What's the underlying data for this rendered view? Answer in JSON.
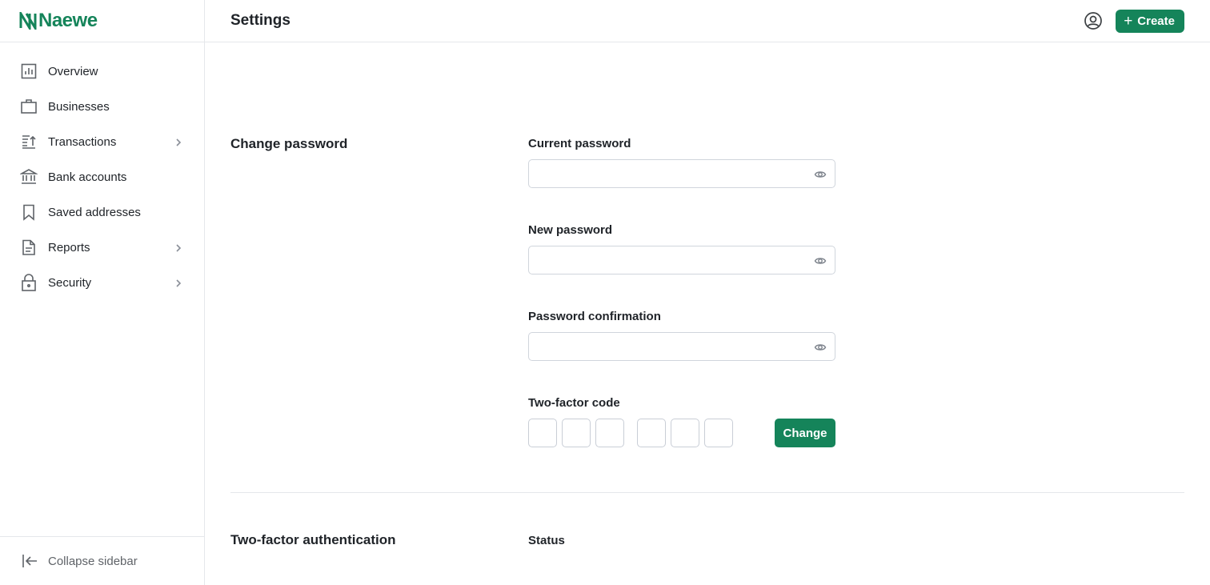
{
  "brand": {
    "name": "Naewe",
    "color": "#15845a"
  },
  "sidebar": {
    "items": [
      {
        "label": "Overview",
        "icon": "bar-chart-icon",
        "has_submenu": false
      },
      {
        "label": "Businesses",
        "icon": "briefcase-icon",
        "has_submenu": false
      },
      {
        "label": "Transactions",
        "icon": "transactions-icon",
        "has_submenu": true
      },
      {
        "label": "Bank accounts",
        "icon": "bank-icon",
        "has_submenu": false
      },
      {
        "label": "Saved addresses",
        "icon": "bookmark-icon",
        "has_submenu": false
      },
      {
        "label": "Reports",
        "icon": "document-icon",
        "has_submenu": true
      },
      {
        "label": "Security",
        "icon": "lock-icon",
        "has_submenu": true
      }
    ],
    "collapse_label": "Collapse sidebar"
  },
  "header": {
    "title": "Settings",
    "create_label": "Create"
  },
  "change_password": {
    "section_title": "Change password",
    "current_password_label": "Current password",
    "current_password_value": "",
    "new_password_label": "New password",
    "new_password_value": "",
    "confirmation_label": "Password confirmation",
    "confirmation_value": "",
    "two_factor_label": "Two-factor code",
    "code_digits": [
      "",
      "",
      "",
      "",
      "",
      ""
    ],
    "submit_label": "Change"
  },
  "two_factor": {
    "section_title": "Two-factor authentication",
    "status_label": "Status"
  },
  "colors": {
    "accent": "#15845a",
    "border": "#e5e7eb",
    "text": "#1f2328"
  }
}
